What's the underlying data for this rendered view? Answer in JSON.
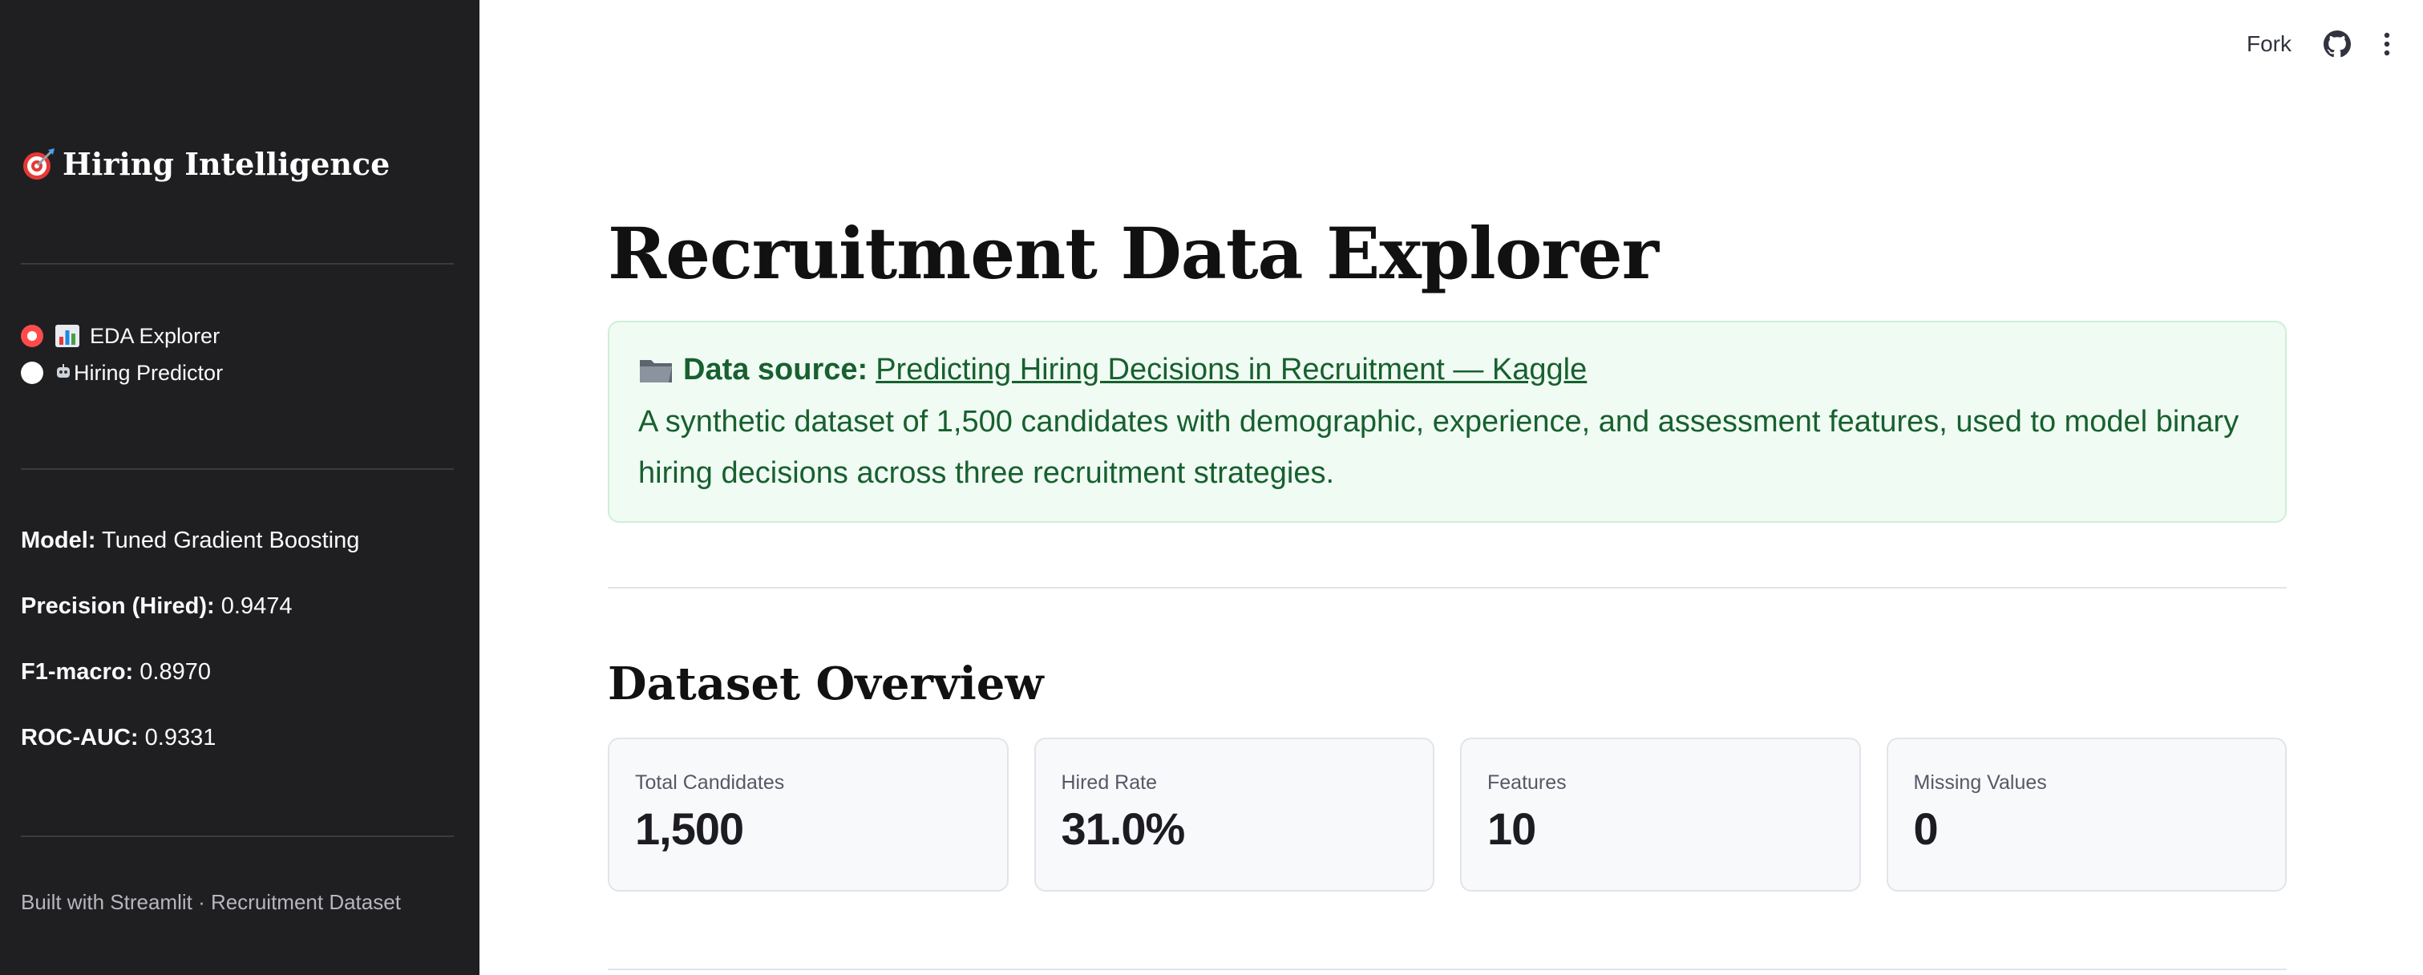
{
  "header": {
    "fork_label": "Fork"
  },
  "sidebar": {
    "title": "Hiring Intelligence",
    "title_icon": "dart-target-icon",
    "nav": [
      {
        "label": "EDA Explorer",
        "icon": "bar-chart-icon",
        "selected": true
      },
      {
        "label": "Hiring Predictor",
        "icon": "robot-icon",
        "selected": false
      }
    ],
    "metrics": [
      {
        "label": "Model:",
        "value": "Tuned Gradient Boosting"
      },
      {
        "label": "Precision (Hired):",
        "value": "0.9474"
      },
      {
        "label": "F1-macro:",
        "value": "0.8970"
      },
      {
        "label": "ROC-AUC:",
        "value": "0.9331"
      }
    ],
    "footer": "Built with Streamlit · Recruitment Dataset"
  },
  "main": {
    "title": "Recruitment Data Explorer",
    "info": {
      "label": "Data source:",
      "link_text": "Predicting Hiring Decisions in Recruitment — Kaggle",
      "description": "A synthetic dataset of 1,500 candidates with demographic, experience, and assessment features, used to model binary hiring decisions across three recruitment strategies."
    },
    "overview_title": "Dataset Overview",
    "cards": [
      {
        "label": "Total Candidates",
        "value": "1,500"
      },
      {
        "label": "Hired Rate",
        "value": "31.0%"
      },
      {
        "label": "Features",
        "value": "10"
      },
      {
        "label": "Missing Values",
        "value": "0"
      }
    ]
  },
  "colors": {
    "sidebar_bg": "#1f1f21",
    "accent": "#ff4b4b",
    "info_bg": "#f0fbf3",
    "info_text": "#17602f"
  }
}
